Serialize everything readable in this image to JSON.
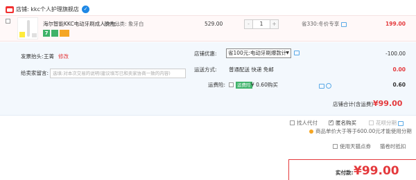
{
  "shop": {
    "label": "店铺:",
    "name": "kkc个人护理旗舰店"
  },
  "product": {
    "title": "海尔智能KKC电动牙刷成人充电...",
    "spec_label": "颜色分类:",
    "spec_value": "象牙白",
    "badges": [
      "7",
      "",
      ""
    ],
    "unit_price": "529.00",
    "quantity": "1",
    "minus_label": "-",
    "plus_label": "+",
    "saved_text": "省330:冬价专享",
    "subtotal": "199.00"
  },
  "invoice": {
    "label": "发票抬头:",
    "name": "王菁",
    "edit_label": "修改"
  },
  "message": {
    "label": "给卖家留言:",
    "placeholder": "选填:对本次交易的说明(建议填写已和卖家协商一致的内容)"
  },
  "discount": {
    "label": "店铺优惠:",
    "selected": "省100元:电动牙刷爆款计",
    "value": "-100.00"
  },
  "shipping": {
    "label": "运送方式:",
    "options": "普通配送 快递 免邮",
    "value": "0.00"
  },
  "insurance": {
    "label": "运费险:",
    "tag": "运费险",
    "price": "¥ 0.60购买",
    "value": "0.60"
  },
  "store_total": {
    "label": "店铺合计(含运费)",
    "value": "¥99.00"
  },
  "payment_options": {
    "help_pay": "找人代付",
    "anonymous": "匿名购买",
    "huabei": "花呗分期",
    "huabei_note": "商品单价大于等于600.00元才能使用分期"
  },
  "tmall": {
    "coupon": "使用天猫点券",
    "topup": "猫卷时抵扣"
  },
  "footer": {
    "label": "实付款:",
    "value": "¥99.00"
  }
}
